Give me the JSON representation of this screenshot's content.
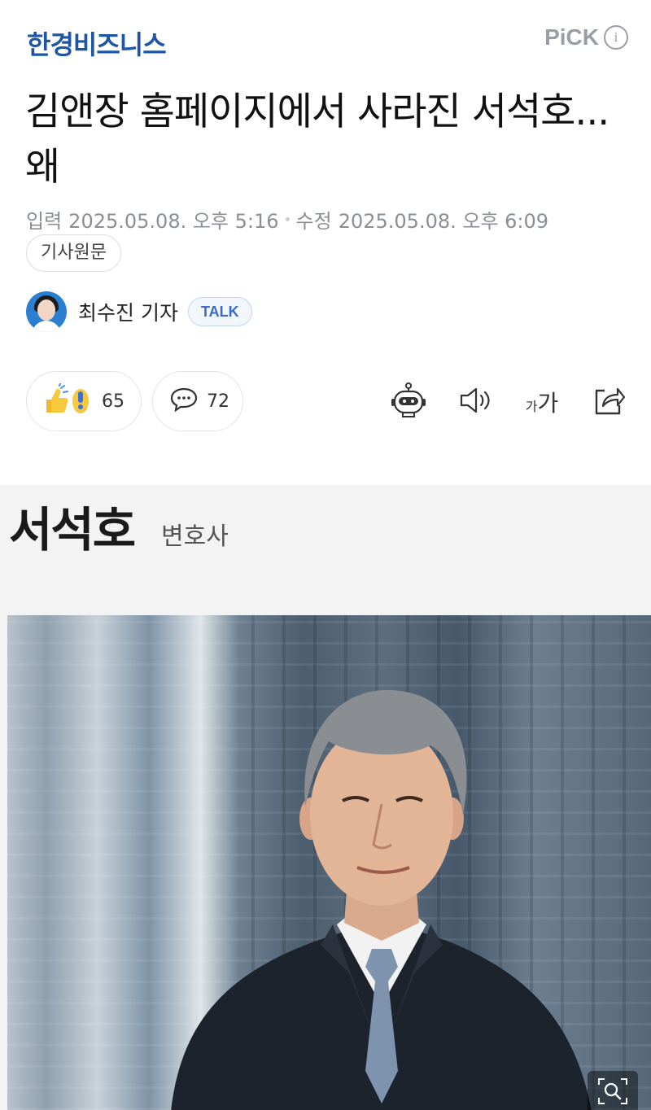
{
  "header": {
    "brand": "한경비즈니스",
    "pick_label": "PiCK",
    "info_icon": "i"
  },
  "article": {
    "headline": "김앤장 홈페이지에서 사라진 서석호...왜",
    "input_label": "입력",
    "input_date": "2025.05.08. 오후 5:16",
    "modified_label": "수정",
    "modified_date": "2025.05.08. 오후 6:09",
    "original_button": "기사원문"
  },
  "author": {
    "name": "최수진 기자",
    "talk_label": "TALK"
  },
  "actions": {
    "reaction_count": "65",
    "comment_count": "72",
    "font_small": "가",
    "font_large": "가"
  },
  "figure": {
    "person_name": "서석호",
    "person_title": "변호사"
  },
  "colors": {
    "brand": "#1f56a4",
    "muted": "#8b8f95",
    "talk": "#3a6cc4"
  },
  "icons": [
    "info-icon",
    "reaction-icon",
    "comment-icon",
    "ai-robot-icon",
    "speaker-icon",
    "font-size-icon",
    "share-icon",
    "zoom-icon"
  ]
}
